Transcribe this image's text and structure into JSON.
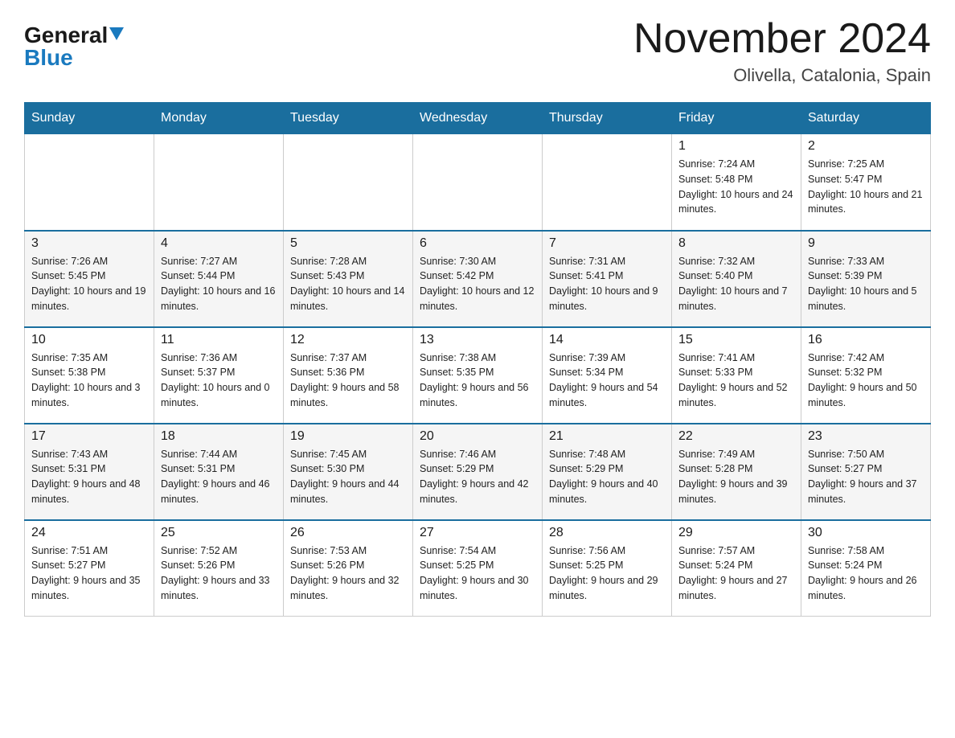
{
  "logo": {
    "general": "General",
    "blue": "Blue"
  },
  "title": {
    "month": "November 2024",
    "location": "Olivella, Catalonia, Spain"
  },
  "headers": [
    "Sunday",
    "Monday",
    "Tuesday",
    "Wednesday",
    "Thursday",
    "Friday",
    "Saturday"
  ],
  "weeks": [
    [
      {
        "day": "",
        "sunrise": "",
        "sunset": "",
        "daylight": ""
      },
      {
        "day": "",
        "sunrise": "",
        "sunset": "",
        "daylight": ""
      },
      {
        "day": "",
        "sunrise": "",
        "sunset": "",
        "daylight": ""
      },
      {
        "day": "",
        "sunrise": "",
        "sunset": "",
        "daylight": ""
      },
      {
        "day": "",
        "sunrise": "",
        "sunset": "",
        "daylight": ""
      },
      {
        "day": "1",
        "sunrise": "Sunrise: 7:24 AM",
        "sunset": "Sunset: 5:48 PM",
        "daylight": "Daylight: 10 hours and 24 minutes."
      },
      {
        "day": "2",
        "sunrise": "Sunrise: 7:25 AM",
        "sunset": "Sunset: 5:47 PM",
        "daylight": "Daylight: 10 hours and 21 minutes."
      }
    ],
    [
      {
        "day": "3",
        "sunrise": "Sunrise: 7:26 AM",
        "sunset": "Sunset: 5:45 PM",
        "daylight": "Daylight: 10 hours and 19 minutes."
      },
      {
        "day": "4",
        "sunrise": "Sunrise: 7:27 AM",
        "sunset": "Sunset: 5:44 PM",
        "daylight": "Daylight: 10 hours and 16 minutes."
      },
      {
        "day": "5",
        "sunrise": "Sunrise: 7:28 AM",
        "sunset": "Sunset: 5:43 PM",
        "daylight": "Daylight: 10 hours and 14 minutes."
      },
      {
        "day": "6",
        "sunrise": "Sunrise: 7:30 AM",
        "sunset": "Sunset: 5:42 PM",
        "daylight": "Daylight: 10 hours and 12 minutes."
      },
      {
        "day": "7",
        "sunrise": "Sunrise: 7:31 AM",
        "sunset": "Sunset: 5:41 PM",
        "daylight": "Daylight: 10 hours and 9 minutes."
      },
      {
        "day": "8",
        "sunrise": "Sunrise: 7:32 AM",
        "sunset": "Sunset: 5:40 PM",
        "daylight": "Daylight: 10 hours and 7 minutes."
      },
      {
        "day": "9",
        "sunrise": "Sunrise: 7:33 AM",
        "sunset": "Sunset: 5:39 PM",
        "daylight": "Daylight: 10 hours and 5 minutes."
      }
    ],
    [
      {
        "day": "10",
        "sunrise": "Sunrise: 7:35 AM",
        "sunset": "Sunset: 5:38 PM",
        "daylight": "Daylight: 10 hours and 3 minutes."
      },
      {
        "day": "11",
        "sunrise": "Sunrise: 7:36 AM",
        "sunset": "Sunset: 5:37 PM",
        "daylight": "Daylight: 10 hours and 0 minutes."
      },
      {
        "day": "12",
        "sunrise": "Sunrise: 7:37 AM",
        "sunset": "Sunset: 5:36 PM",
        "daylight": "Daylight: 9 hours and 58 minutes."
      },
      {
        "day": "13",
        "sunrise": "Sunrise: 7:38 AM",
        "sunset": "Sunset: 5:35 PM",
        "daylight": "Daylight: 9 hours and 56 minutes."
      },
      {
        "day": "14",
        "sunrise": "Sunrise: 7:39 AM",
        "sunset": "Sunset: 5:34 PM",
        "daylight": "Daylight: 9 hours and 54 minutes."
      },
      {
        "day": "15",
        "sunrise": "Sunrise: 7:41 AM",
        "sunset": "Sunset: 5:33 PM",
        "daylight": "Daylight: 9 hours and 52 minutes."
      },
      {
        "day": "16",
        "sunrise": "Sunrise: 7:42 AM",
        "sunset": "Sunset: 5:32 PM",
        "daylight": "Daylight: 9 hours and 50 minutes."
      }
    ],
    [
      {
        "day": "17",
        "sunrise": "Sunrise: 7:43 AM",
        "sunset": "Sunset: 5:31 PM",
        "daylight": "Daylight: 9 hours and 48 minutes."
      },
      {
        "day": "18",
        "sunrise": "Sunrise: 7:44 AM",
        "sunset": "Sunset: 5:31 PM",
        "daylight": "Daylight: 9 hours and 46 minutes."
      },
      {
        "day": "19",
        "sunrise": "Sunrise: 7:45 AM",
        "sunset": "Sunset: 5:30 PM",
        "daylight": "Daylight: 9 hours and 44 minutes."
      },
      {
        "day": "20",
        "sunrise": "Sunrise: 7:46 AM",
        "sunset": "Sunset: 5:29 PM",
        "daylight": "Daylight: 9 hours and 42 minutes."
      },
      {
        "day": "21",
        "sunrise": "Sunrise: 7:48 AM",
        "sunset": "Sunset: 5:29 PM",
        "daylight": "Daylight: 9 hours and 40 minutes."
      },
      {
        "day": "22",
        "sunrise": "Sunrise: 7:49 AM",
        "sunset": "Sunset: 5:28 PM",
        "daylight": "Daylight: 9 hours and 39 minutes."
      },
      {
        "day": "23",
        "sunrise": "Sunrise: 7:50 AM",
        "sunset": "Sunset: 5:27 PM",
        "daylight": "Daylight: 9 hours and 37 minutes."
      }
    ],
    [
      {
        "day": "24",
        "sunrise": "Sunrise: 7:51 AM",
        "sunset": "Sunset: 5:27 PM",
        "daylight": "Daylight: 9 hours and 35 minutes."
      },
      {
        "day": "25",
        "sunrise": "Sunrise: 7:52 AM",
        "sunset": "Sunset: 5:26 PM",
        "daylight": "Daylight: 9 hours and 33 minutes."
      },
      {
        "day": "26",
        "sunrise": "Sunrise: 7:53 AM",
        "sunset": "Sunset: 5:26 PM",
        "daylight": "Daylight: 9 hours and 32 minutes."
      },
      {
        "day": "27",
        "sunrise": "Sunrise: 7:54 AM",
        "sunset": "Sunset: 5:25 PM",
        "daylight": "Daylight: 9 hours and 30 minutes."
      },
      {
        "day": "28",
        "sunrise": "Sunrise: 7:56 AM",
        "sunset": "Sunset: 5:25 PM",
        "daylight": "Daylight: 9 hours and 29 minutes."
      },
      {
        "day": "29",
        "sunrise": "Sunrise: 7:57 AM",
        "sunset": "Sunset: 5:24 PM",
        "daylight": "Daylight: 9 hours and 27 minutes."
      },
      {
        "day": "30",
        "sunrise": "Sunrise: 7:58 AM",
        "sunset": "Sunset: 5:24 PM",
        "daylight": "Daylight: 9 hours and 26 minutes."
      }
    ]
  ]
}
